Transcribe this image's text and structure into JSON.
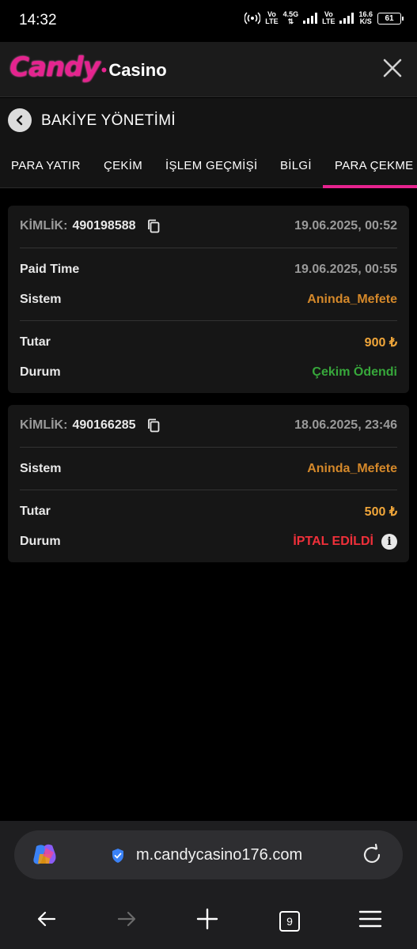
{
  "status_bar": {
    "time": "14:32",
    "network1": "Vo\nLTE",
    "network_gen": "4.5G",
    "network2": "Vo\nLTE",
    "speed": "16.6\nK/S",
    "battery": "61"
  },
  "app": {
    "logo_candy": "Candy",
    "logo_casino": "Casino",
    "brand_color": "#e6238f"
  },
  "page": {
    "title": "BAKİYE YÖNETİMİ"
  },
  "tabs": [
    {
      "label": "PARA YATIR"
    },
    {
      "label": "ÇEKİM"
    },
    {
      "label": "İŞLEM GEÇMİŞİ"
    },
    {
      "label": "BİLGİ"
    },
    {
      "label": "PARA ÇEKME İ"
    }
  ],
  "active_tab": 4,
  "transactions": [
    {
      "id_label": "KİMLİK:",
      "id": "490198588",
      "date": "19.06.2025, 00:52",
      "paid_time_label": "Paid Time",
      "paid_time": "19.06.2025, 00:55",
      "system_label": "Sistem",
      "system": "Aninda_Mefete",
      "amount_label": "Tutar",
      "amount": "900 ₺",
      "status_label": "Durum",
      "status": "Çekim Ödendi"
    },
    {
      "id_label": "KİMLİK:",
      "id": "490166285",
      "date": "18.06.2025, 23:46",
      "system_label": "Sistem",
      "system": "Aninda_Mefete",
      "amount_label": "Tutar",
      "amount": "500 ₺",
      "status_label": "Durum",
      "status": "İPTAL EDİLDİ"
    }
  ],
  "browser": {
    "url": "m.candycasino176.com",
    "tab_count": "9"
  },
  "colors": {
    "system": "#d4882a",
    "amount": "#f0a63a",
    "paid": "#37a83b",
    "cancelled": "#f0303a"
  }
}
